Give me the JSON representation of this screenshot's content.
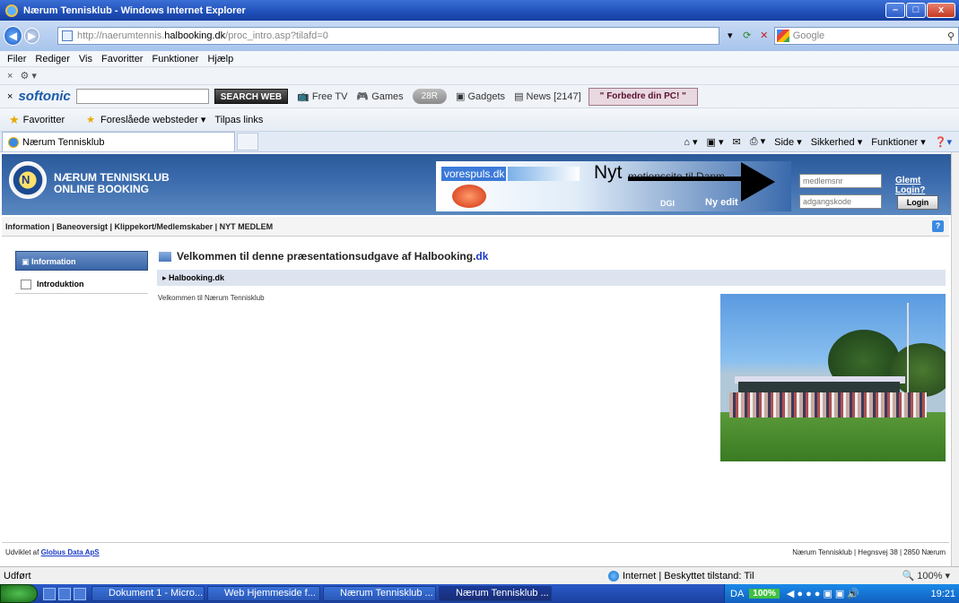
{
  "window": {
    "title": "Nærum Tennisklub - Windows Internet Explorer",
    "buttons": [
      "–",
      "□",
      "x"
    ]
  },
  "address": {
    "url_prefix": "http://naerumtennis.",
    "url_domain": "halbooking.dk",
    "url_suffix": "/proc_intro.asp?tilafd=0",
    "search_placeholder": "Google",
    "nav_back": "◀",
    "nav_fwd": "▶"
  },
  "menu": [
    "Filer",
    "Rediger",
    "Vis",
    "Favoritter",
    "Funktioner",
    "Hjælp"
  ],
  "toolbar2": {
    "brand": "softonic",
    "search_button": "SEARCH WEB",
    "free_tv": "Free TV",
    "games": "Games",
    "pill": "28R",
    "gadgets": "Gadgets",
    "news": "News [2147]",
    "improve": "\" Forbedre din PC! \""
  },
  "favbar": {
    "favorites": "Favoritter",
    "suggested": "Foreslåede websteder ▾",
    "links": "Tilpas links"
  },
  "tab": {
    "label": "Nærum Tennisklub",
    "cmd": [
      "Side ▾",
      "Sikkerhed ▾",
      "Funktioner ▾"
    ]
  },
  "site": {
    "brand_line1": "NÆRUM TENNISKLUB",
    "brand_line2": "ONLINE BOOKING",
    "logo_letter": "N",
    "banner": {
      "vorespuls": "vorespuls.dk",
      "nyt": "Nyt",
      "motion": "motionssite til Danm",
      "dgi": "DGI",
      "nyt2": "Ny     edit"
    },
    "login": {
      "user_placeholder": "medlemsnr",
      "pass_placeholder": "adgangskode",
      "forgot": "Glemt Login?",
      "button": "Login"
    },
    "subnav": "Information | Baneoversigt | Klippekort/Medlemskaber | NYT MEDLEM",
    "help": "?",
    "side": {
      "information": "Information",
      "introduktion": "Introduktion"
    },
    "welcome_text": "Velkommen til denne præsentationsudgave af Halbooking.",
    "welcome_dk": "dk",
    "section_title": "Halbooking.dk",
    "intro": "Velkommen til Nærum Tennisklub",
    "footer_left_prefix": "Udviklet af ",
    "footer_left_link": "Globus Data ApS",
    "footer_right": "Nærum Tennisklub | Hegnsvej 38 | 2850 Nærum"
  },
  "status": {
    "left": "Udført",
    "internet": "Internet | Beskyttet tilstand: Til",
    "zoom": "100%"
  },
  "taskbar": {
    "tasks": [
      "Dokument 1 - Micro...",
      "Web Hjemmeside f...",
      "Nærum Tennisklub ...",
      "Nærum Tennisklub ..."
    ],
    "lang": "DA",
    "battery": "100%",
    "clock": "19:21"
  }
}
